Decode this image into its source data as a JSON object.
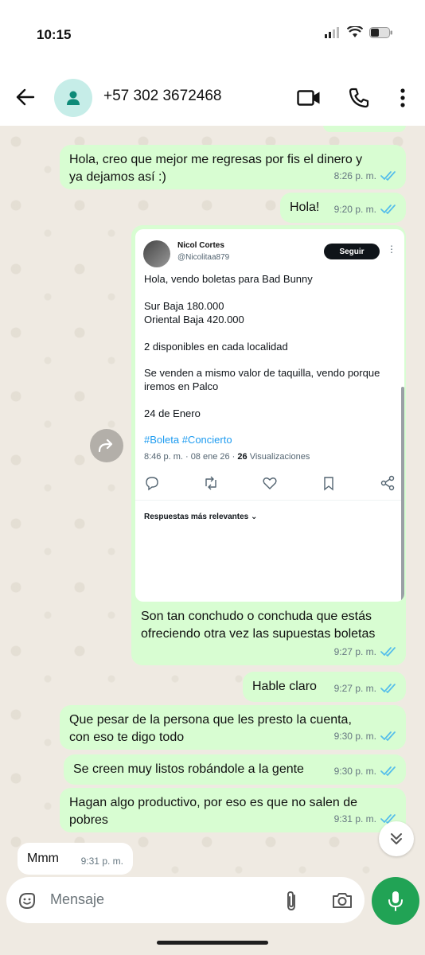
{
  "status": {
    "time": "10:15"
  },
  "header": {
    "contact": "+57 302 3672468"
  },
  "messages": [
    {
      "text": "Hola, creo que mejor me regresas por fis el dinero y\nya dejamos así :)",
      "time": "8:26 p. m."
    },
    {
      "text": "Hola!",
      "time": "9:20 p. m."
    },
    {
      "text": "Son tan conchudo o conchuda que estás\nofreciendo otra vez las supuestas boletas",
      "time": "9:27 p. m."
    },
    {
      "text": "Hable claro",
      "time": "9:27 p. m."
    },
    {
      "text": "Que pesar de la persona que les presto la cuenta,\ncon eso te digo todo",
      "time": "9:30 p. m."
    },
    {
      "text": "Se creen muy listos robándole a la gente",
      "time": "9:30 p. m."
    },
    {
      "text": "Hagan algo productivo, por eso es que no salen de\npobres",
      "time": "9:31 p. m."
    },
    {
      "text": "Mmm",
      "time": "9:31 p. m."
    }
  ],
  "tweet": {
    "name": "Nicol Cortes",
    "handle": "@Nicolitaa879",
    "follow": "Seguir",
    "lines": [
      "Hola, vendo boletas para Bad Bunny",
      "Sur Baja 180.000",
      "Oriental Baja 420.000",
      "2 disponibles en cada localidad",
      "Se venden a mismo valor de taquilla, vendo porque",
      "iremos en Palco",
      "24 de Enero"
    ],
    "tags": "#Boleta #Concierto",
    "date": "8:46 p. m. · 08 ene 26 · ",
    "views_count": "26",
    "views_label": " Visualizaciones",
    "replies": "Respuestas más relevantes"
  },
  "input": {
    "placeholder": "Mensaje"
  },
  "icons": [
    "back-arrow-icon",
    "person-icon",
    "video-call-icon",
    "phone-icon",
    "more-vertical-icon",
    "sticker-icon",
    "attach-icon",
    "camera-icon",
    "mic-icon",
    "forward-icon",
    "double-chevron-down-icon",
    "read-check-icon"
  ],
  "colors": {
    "outgoing": "#d8fdd2",
    "incoming": "#ffffff",
    "accent": "#21a355",
    "ticks": "#53bdeb",
    "chat_bg": "#efeae2"
  }
}
